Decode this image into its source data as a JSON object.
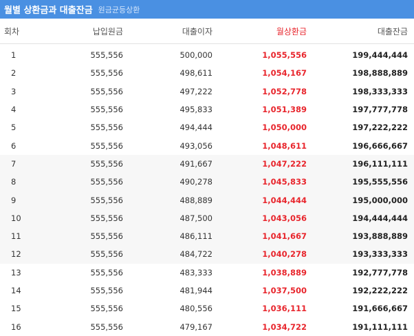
{
  "header": {
    "title": "월별 상환금과 대출잔금",
    "subtitle": "원금균등상환"
  },
  "columns": {
    "no": "회차",
    "principal": "납입원금",
    "interest": "대출이자",
    "payment": "월상환금",
    "balance": "대출잔금"
  },
  "rows": [
    {
      "no": "1",
      "principal": "555,556",
      "interest": "500,000",
      "payment": "1,055,556",
      "balance": "199,444,444"
    },
    {
      "no": "2",
      "principal": "555,556",
      "interest": "498,611",
      "payment": "1,054,167",
      "balance": "198,888,889"
    },
    {
      "no": "3",
      "principal": "555,556",
      "interest": "497,222",
      "payment": "1,052,778",
      "balance": "198,333,333"
    },
    {
      "no": "4",
      "principal": "555,556",
      "interest": "495,833",
      "payment": "1,051,389",
      "balance": "197,777,778"
    },
    {
      "no": "5",
      "principal": "555,556",
      "interest": "494,444",
      "payment": "1,050,000",
      "balance": "197,222,222"
    },
    {
      "no": "6",
      "principal": "555,556",
      "interest": "493,056",
      "payment": "1,048,611",
      "balance": "196,666,667"
    },
    {
      "no": "7",
      "principal": "555,556",
      "interest": "491,667",
      "payment": "1,047,222",
      "balance": "196,111,111"
    },
    {
      "no": "8",
      "principal": "555,556",
      "interest": "490,278",
      "payment": "1,045,833",
      "balance": "195,555,556"
    },
    {
      "no": "9",
      "principal": "555,556",
      "interest": "488,889",
      "payment": "1,044,444",
      "balance": "195,000,000"
    },
    {
      "no": "10",
      "principal": "555,556",
      "interest": "487,500",
      "payment": "1,043,056",
      "balance": "194,444,444"
    },
    {
      "no": "11",
      "principal": "555,556",
      "interest": "486,111",
      "payment": "1,041,667",
      "balance": "193,888,889"
    },
    {
      "no": "12",
      "principal": "555,556",
      "interest": "484,722",
      "payment": "1,040,278",
      "balance": "193,333,333"
    },
    {
      "no": "13",
      "principal": "555,556",
      "interest": "483,333",
      "payment": "1,038,889",
      "balance": "192,777,778"
    },
    {
      "no": "14",
      "principal": "555,556",
      "interest": "481,944",
      "payment": "1,037,500",
      "balance": "192,222,222"
    },
    {
      "no": "15",
      "principal": "555,556",
      "interest": "480,556",
      "payment": "1,036,111",
      "balance": "191,666,667"
    },
    {
      "no": "16",
      "principal": "555,556",
      "interest": "479,167",
      "payment": "1,034,722",
      "balance": "191,111,111"
    }
  ],
  "colors": {
    "header_bg": "#4a90e2",
    "payment_text": "#e8262d",
    "shaded_row_bg": "#f7f7f7"
  }
}
